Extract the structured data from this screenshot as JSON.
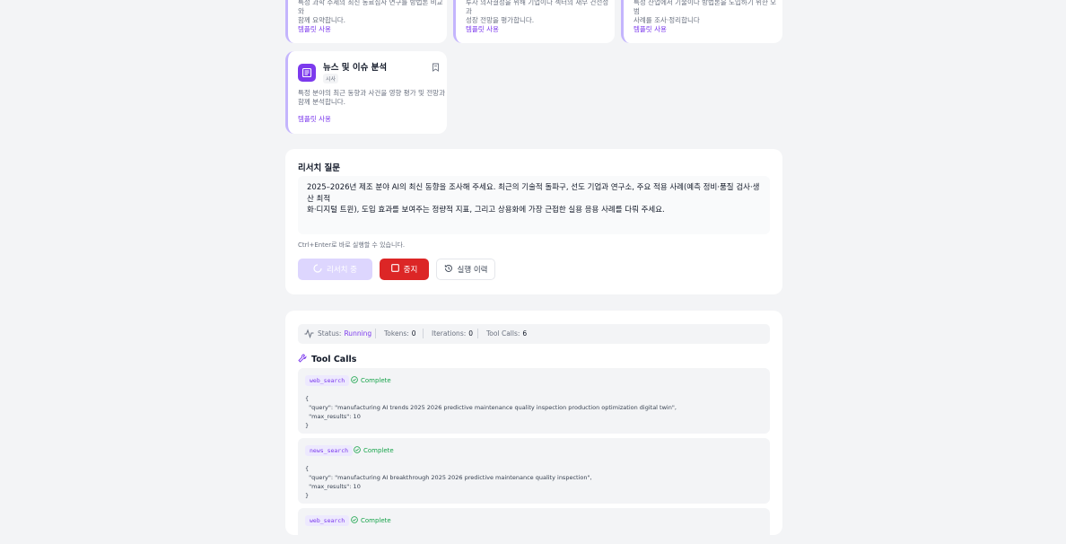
{
  "templates": {
    "use_label": "템플릿 사용",
    "top_row": [
      {
        "desc_lines": [
          "특정 과학 주제의 최신 동료심사 연구를 방법론 비교와",
          "함께 요약합니다."
        ]
      },
      {
        "desc_lines": [
          "투자 의사결정을 위해 기업이나 섹터의 재무 건전성과",
          "성장 전망을 평가합니다."
        ]
      },
      {
        "desc_lines": [
          "특정 산업에서 기술이나 방법론을 도입하기 위한 모범",
          "사례를 조사·정리합니다"
        ]
      }
    ],
    "news": {
      "title": "뉴스 및 이슈 분석",
      "badge": "시사",
      "desc_lines": [
        "특정 분야의 최근 동향과 사건을 영향 평가 및 전망과",
        "함께 분석합니다."
      ],
      "icon": "newspaper-icon",
      "bookmark_icon": "bookmark-icon"
    }
  },
  "research": {
    "section_title": "리서치 질문",
    "query_lines": [
      "2025–2026년 제조 분야 AI의 최신 동향을 조사해 주세요. 최근의 기술적 돌파구, 선도 기업과 연구소, 주요 적용 사례(예측 정비·품질 검사·생산 최적",
      "화·디지털 트윈), 도입 효과를 보여주는 정량적 지표, 그리고 상용화에 가장 근접한 실용 응용 사례를 다뤄 주세요."
    ],
    "hint": "Ctrl+Enter로 바로 실행할 수 있습니다.",
    "run_button": "리서치 중",
    "stop_button": "중지",
    "history_button": "실행 이력"
  },
  "status": {
    "status_label": "Status:",
    "status_value": "Running",
    "tokens_label": "Tokens:",
    "tokens_value": "0",
    "iterations_label": "Iterations:",
    "iterations_value": "0",
    "toolcalls_label": "Tool Calls:",
    "toolcalls_value": "6"
  },
  "tool_calls": {
    "title": "Tool Calls",
    "items": [
      {
        "tool": "web_search",
        "status": "Complete",
        "lines": [
          "{",
          "  \"query\": \"manufacturing AI trends 2025 2026 predictive maintenance quality inspection production optimization digital twin\",",
          "  \"max_results\": 10",
          "}"
        ]
      },
      {
        "tool": "news_search",
        "status": "Complete",
        "lines": [
          "{",
          "  \"query\": \"manufacturing AI breakthrough 2025 2026 predictive maintenance quality inspection\",",
          "  \"max_results\": 10",
          "}"
        ]
      },
      {
        "tool": "web_search",
        "status": "Complete",
        "lines": []
      }
    ]
  },
  "colors": {
    "accent": "#7c3aed",
    "stop": "#dc2626",
    "complete": "#16a34a"
  }
}
